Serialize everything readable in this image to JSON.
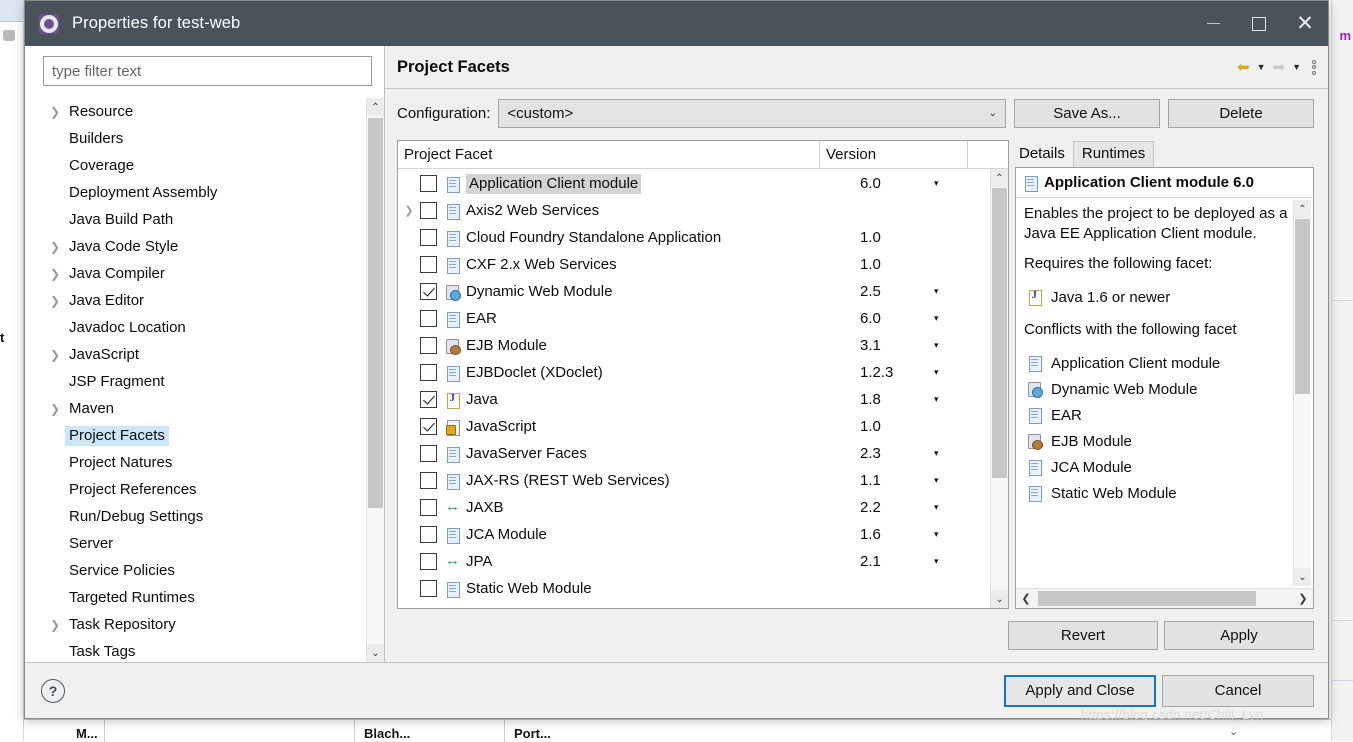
{
  "window": {
    "title": "Properties for test-web",
    "icon": "properties-gear-icon",
    "minimize_label": "Minimize",
    "maximize_label": "Maximize",
    "close_label": "Close"
  },
  "filter": {
    "placeholder": "type filter text",
    "value": ""
  },
  "sidebar": {
    "items": [
      {
        "label": "Resource",
        "expandable": true,
        "selected": false
      },
      {
        "label": "Builders",
        "expandable": false,
        "selected": false
      },
      {
        "label": "Coverage",
        "expandable": false,
        "selected": false
      },
      {
        "label": "Deployment Assembly",
        "expandable": false,
        "selected": false
      },
      {
        "label": "Java Build Path",
        "expandable": false,
        "selected": false
      },
      {
        "label": "Java Code Style",
        "expandable": true,
        "selected": false
      },
      {
        "label": "Java Compiler",
        "expandable": true,
        "selected": false
      },
      {
        "label": "Java Editor",
        "expandable": true,
        "selected": false
      },
      {
        "label": "Javadoc Location",
        "expandable": false,
        "selected": false
      },
      {
        "label": "JavaScript",
        "expandable": true,
        "selected": false
      },
      {
        "label": "JSP Fragment",
        "expandable": false,
        "selected": false
      },
      {
        "label": "Maven",
        "expandable": true,
        "selected": false
      },
      {
        "label": "Project Facets",
        "expandable": false,
        "selected": true
      },
      {
        "label": "Project Natures",
        "expandable": false,
        "selected": false
      },
      {
        "label": "Project References",
        "expandable": false,
        "selected": false
      },
      {
        "label": "Run/Debug Settings",
        "expandable": false,
        "selected": false
      },
      {
        "label": "Server",
        "expandable": false,
        "selected": false
      },
      {
        "label": "Service Policies",
        "expandable": false,
        "selected": false
      },
      {
        "label": "Targeted Runtimes",
        "expandable": false,
        "selected": false
      },
      {
        "label": "Task Repository",
        "expandable": true,
        "selected": false
      },
      {
        "label": "Task Tags",
        "expandable": false,
        "selected": false
      }
    ]
  },
  "page": {
    "title": "Project Facets",
    "toolbar": {
      "back_icon": "back-arrow-icon",
      "back_caret_icon": "chevron-down-icon",
      "forward_icon": "forward-arrow-icon",
      "forward_caret_icon": "chevron-down-icon",
      "more_icon": "view-menu-icon"
    }
  },
  "configuration": {
    "label": "Configuration:",
    "value": "<custom>",
    "save_as_label": "Save As...",
    "delete_label": "Delete"
  },
  "facet_table": {
    "columns": {
      "name": "Project Facet",
      "version": "Version"
    },
    "rows": [
      {
        "name": "Application Client module",
        "version": "6.0",
        "checked": false,
        "expandable": false,
        "has_version_menu": true,
        "icon": "doc",
        "highlighted": true
      },
      {
        "name": "Axis2 Web Services",
        "version": "",
        "checked": false,
        "expandable": true,
        "has_version_menu": false,
        "icon": "doc",
        "highlighted": false
      },
      {
        "name": "Cloud Foundry Standalone Application",
        "version": "1.0",
        "checked": false,
        "expandable": false,
        "has_version_menu": false,
        "icon": "doc",
        "highlighted": false
      },
      {
        "name": "CXF 2.x Web Services",
        "version": "1.0",
        "checked": false,
        "expandable": false,
        "has_version_menu": false,
        "icon": "doc",
        "highlighted": false
      },
      {
        "name": "Dynamic Web Module",
        "version": "2.5",
        "checked": true,
        "expandable": false,
        "has_version_menu": true,
        "icon": "webjar",
        "highlighted": false
      },
      {
        "name": "EAR",
        "version": "6.0",
        "checked": false,
        "expandable": false,
        "has_version_menu": true,
        "icon": "doc",
        "highlighted": false
      },
      {
        "name": "EJB Module",
        "version": "3.1",
        "checked": false,
        "expandable": false,
        "has_version_menu": true,
        "icon": "ejb",
        "highlighted": false
      },
      {
        "name": "EJBDoclet (XDoclet)",
        "version": "1.2.3",
        "checked": false,
        "expandable": false,
        "has_version_menu": true,
        "icon": "doc",
        "highlighted": false
      },
      {
        "name": "Java",
        "version": "1.8",
        "checked": true,
        "expandable": false,
        "has_version_menu": true,
        "icon": "java",
        "highlighted": false
      },
      {
        "name": "JavaScript",
        "version": "1.0",
        "checked": true,
        "expandable": false,
        "has_version_menu": false,
        "icon": "js",
        "highlighted": false
      },
      {
        "name": "JavaServer Faces",
        "version": "2.3",
        "checked": false,
        "expandable": false,
        "has_version_menu": true,
        "icon": "doc",
        "highlighted": false
      },
      {
        "name": "JAX-RS (REST Web Services)",
        "version": "1.1",
        "checked": false,
        "expandable": false,
        "has_version_menu": true,
        "icon": "doc",
        "highlighted": false
      },
      {
        "name": "JAXB",
        "version": "2.2",
        "checked": false,
        "expandable": false,
        "has_version_menu": true,
        "icon": "arrows",
        "highlighted": false
      },
      {
        "name": "JCA Module",
        "version": "1.6",
        "checked": false,
        "expandable": false,
        "has_version_menu": true,
        "icon": "doc",
        "highlighted": false
      },
      {
        "name": "JPA",
        "version": "2.1",
        "checked": false,
        "expandable": false,
        "has_version_menu": true,
        "icon": "arrows",
        "highlighted": false
      },
      {
        "name": "Static Web Module",
        "version": "",
        "checked": false,
        "expandable": false,
        "has_version_menu": false,
        "icon": "doc",
        "highlighted": false
      }
    ]
  },
  "details": {
    "tabs": [
      {
        "label": "Details",
        "active": true
      },
      {
        "label": "Runtimes",
        "active": false
      }
    ],
    "header": {
      "title": "Application Client module 6.0",
      "icon": "doc"
    },
    "description": "Enables the project to be deployed as a Java EE Application Client module.",
    "requires_heading": "Requires the following facet:",
    "requires": [
      {
        "label": "Java 1.6 or newer",
        "icon": "java"
      }
    ],
    "conflicts_heading": "Conflicts with the following facet",
    "conflicts": [
      {
        "label": "Application Client module",
        "icon": "doc"
      },
      {
        "label": "Dynamic Web Module",
        "icon": "webjar"
      },
      {
        "label": "EAR",
        "icon": "doc"
      },
      {
        "label": "EJB Module",
        "icon": "ejb"
      },
      {
        "label": "JCA Module",
        "icon": "doc"
      },
      {
        "label": "Static Web Module",
        "icon": "doc"
      }
    ]
  },
  "page_buttons": {
    "revert": "Revert",
    "apply": "Apply"
  },
  "footer": {
    "help_icon": "help-question-icon",
    "apply_and_close": "Apply and Close",
    "cancel": "Cancel"
  },
  "watermark": "https://blog.csdn.net/Chill_Lyn",
  "background": {
    "left_text": "t",
    "right_text": "m",
    "bottom_columns": [
      "M...",
      "Blach...",
      "Port..."
    ]
  },
  "colors": {
    "titlebar": "#4a535c",
    "selection": "#cde6f7",
    "focus_border": "#1177d1",
    "row_highlight": "#d4d4d4"
  }
}
